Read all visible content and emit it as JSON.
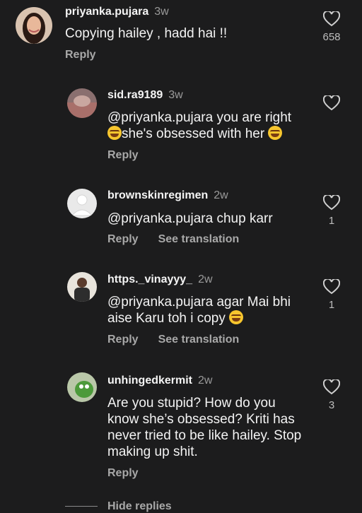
{
  "comments": [
    {
      "user": "priyanka.pujara",
      "time": "3w",
      "text": "Copying hailey , hadd hai !!",
      "reply": "Reply",
      "likes": "658"
    },
    {
      "user": "sid.ra9189",
      "time": "3w",
      "text_line1": "@priyanka.pujara you are right",
      "text_line2": "she's obsessed with her",
      "reply": "Reply"
    },
    {
      "user": "brownskinregimen",
      "time": "2w",
      "text": "@priyanka.pujara chup karr",
      "reply": "Reply",
      "translate": "See translation",
      "likes": "1"
    },
    {
      "user": "https._vinayyy_",
      "time": "2w",
      "text_line1": "@priyanka.pujara agar Mai bhi",
      "text_line2": "aise Karu toh i copy",
      "reply": "Reply",
      "translate": "See translation",
      "likes": "1"
    },
    {
      "user": "unhingedkermit",
      "time": "2w",
      "text_lines": [
        "Are you stupid? How do you",
        "know she’s obsessed? Kriti has",
        "never tried to be like hailey. Stop",
        "making up shit."
      ],
      "reply": "Reply",
      "likes": "3"
    }
  ],
  "hide_replies": "Hide replies",
  "icons": {
    "like": "heart-outline-icon",
    "emoji": "laughing-tears-emoji"
  }
}
